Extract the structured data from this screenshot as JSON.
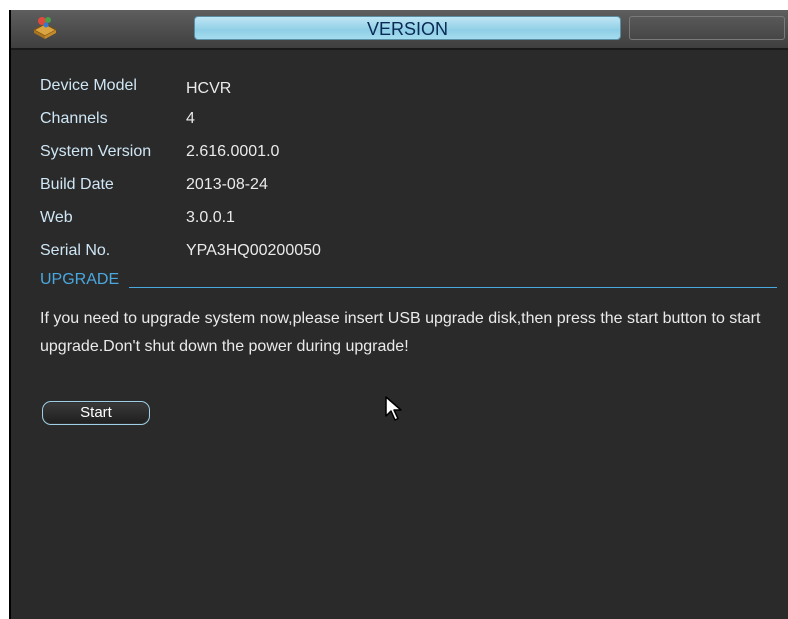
{
  "window": {
    "title": "VERSION",
    "icon": "app-icon"
  },
  "info": [
    {
      "label": "Device Model",
      "value": "HCVR"
    },
    {
      "label": "Channels",
      "value": "4"
    },
    {
      "label": "System Version",
      "value": "2.616.0001.0"
    },
    {
      "label": "Build Date",
      "value": "2013-08-24"
    },
    {
      "label": "Web",
      "value": "3.0.0.1"
    },
    {
      "label": "Serial No.",
      "value": "YPA3HQ00200050"
    }
  ],
  "upgrade": {
    "section_title": "UPGRADE",
    "notice": "If you need to upgrade system now,please insert USB upgrade disk,then press the start button to start upgrade.Don't shut down the power during upgrade!",
    "start_label": "Start"
  },
  "colors": {
    "background": "#2a2a2a",
    "accent": "#4aa8e0",
    "title_pill": "#a6dcee"
  }
}
